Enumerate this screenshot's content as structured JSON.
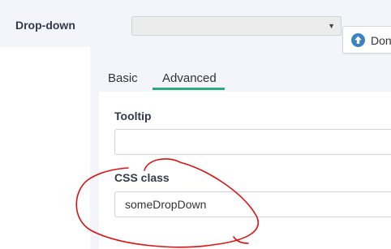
{
  "field": {
    "label": "Drop-down",
    "select_value": ""
  },
  "done_button": {
    "label": "Don",
    "icon": "arrow-up-circle-icon"
  },
  "tabs": [
    {
      "label": "Basic",
      "active": false
    },
    {
      "label": "Advanced",
      "active": true
    }
  ],
  "properties": {
    "tooltip_label": "Tooltip",
    "tooltip_value": "",
    "css_class_label": "CSS class",
    "css_class_value": "someDropDown"
  },
  "colors": {
    "accent": "#2bab7e",
    "annotation": "#e01010",
    "icon": "#3b82c4"
  }
}
